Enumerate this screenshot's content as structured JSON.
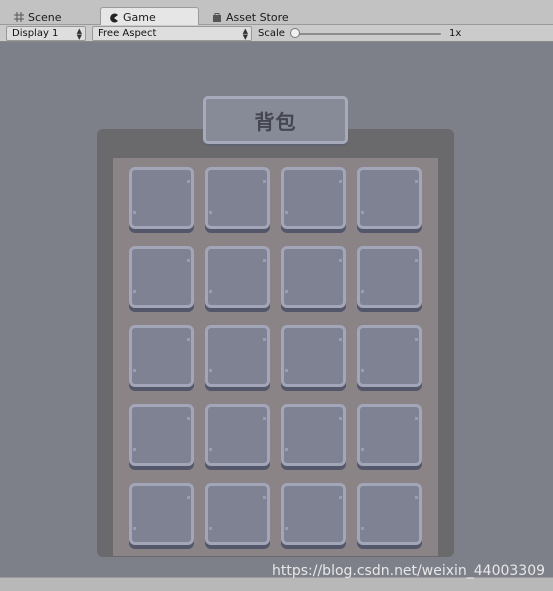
{
  "tabs": [
    {
      "label": "Scene",
      "icon": "grid-icon"
    },
    {
      "label": "Game",
      "icon": "pacman-icon",
      "active": true
    },
    {
      "label": "Asset Store",
      "icon": "bag-icon"
    }
  ],
  "toolbar": {
    "display": "Display 1",
    "aspect": "Free Aspect",
    "scale_label": "Scale",
    "scale_value": "1x"
  },
  "game": {
    "title": "背包",
    "grid_rows": 5,
    "grid_cols": 4
  },
  "watermark": "https://blog.csdn.net/weixin_44003309",
  "colors": {
    "game_bg": "#7d8088",
    "panel_outer": "#6a6a6c",
    "panel_inner": "#8a8487",
    "slot_fill": "#7e8292",
    "slot_border": "#a2a6b8"
  }
}
